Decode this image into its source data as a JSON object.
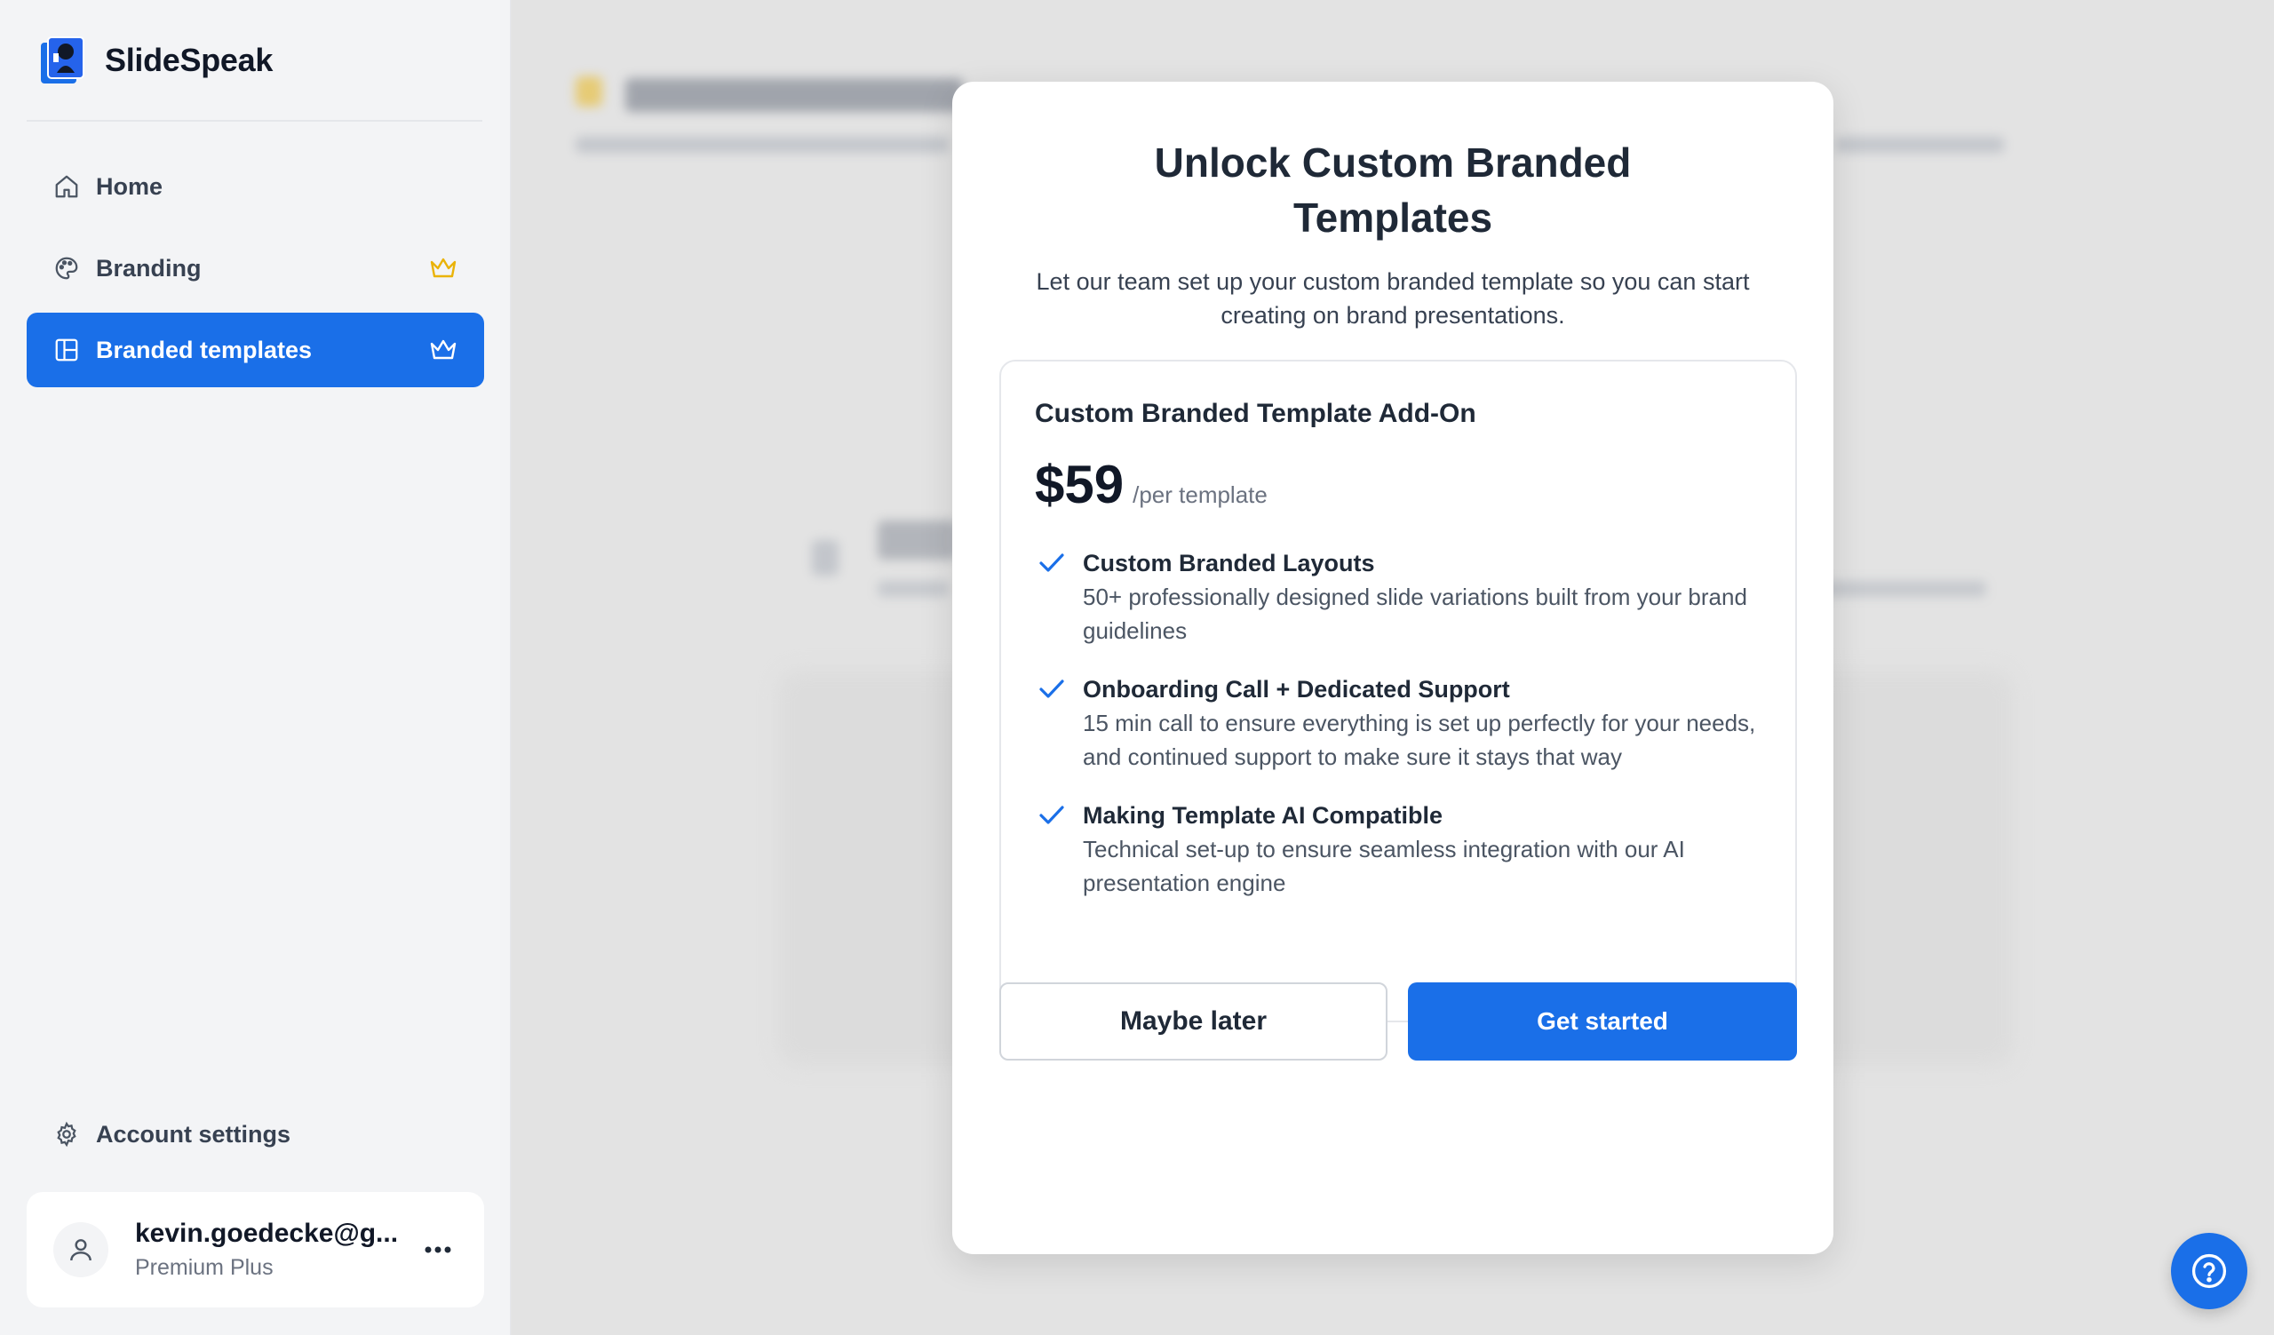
{
  "app": {
    "name": "SlideSpeak"
  },
  "sidebar": {
    "items": [
      {
        "label": "Home",
        "icon": "home-icon",
        "premium": false,
        "active": false
      },
      {
        "label": "Branding",
        "icon": "palette-icon",
        "premium": true,
        "active": false
      },
      {
        "label": "Branded templates",
        "icon": "layout-icon",
        "premium": true,
        "active": true
      }
    ],
    "account_settings_label": "Account settings",
    "user": {
      "email": "kevin.goedecke@g...",
      "plan": "Premium Plus"
    }
  },
  "modal": {
    "title_line1": "Unlock Custom Branded",
    "title_line2": "Templates",
    "subtitle": "Let our team set up your custom branded template so you can start creating on brand presentations.",
    "card": {
      "name": "Custom Branded Template Add-On",
      "price": "$59",
      "price_unit": "/per template",
      "features": [
        {
          "title": "Custom Branded Layouts",
          "description": "50+ professionally designed slide variations built from your brand guidelines"
        },
        {
          "title": "Onboarding Call + Dedicated Support",
          "description": "15 min call to ensure everything is set up perfectly for your needs, and continued support to make sure it stays that way"
        },
        {
          "title": "Making Template AI Compatible",
          "description": "Technical set-up to ensure seamless integration with our AI presentation engine"
        }
      ]
    },
    "secondary_button": "Maybe later",
    "primary_button": "Get started"
  },
  "colors": {
    "accent": "#1a6fe8",
    "crown": "#eab308",
    "sidebar_bg": "#f3f4f6",
    "overlay_bg": "#e3e3e3"
  }
}
